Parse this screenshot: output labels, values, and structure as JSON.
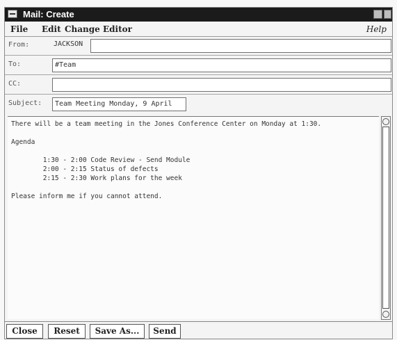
{
  "window": {
    "title": "Mail: Create"
  },
  "menu": {
    "file": "File",
    "edit": "Edit",
    "change_editor": "Change Editor",
    "help": "Help"
  },
  "header": {
    "from_label": "From:",
    "from_value": "JACKSON",
    "to_label": "To:",
    "to_value": "#Team",
    "cc_label": "CC:",
    "cc_value": "",
    "subject_label": "Subject:",
    "subject_value": "Team Meeting Monday, 9 April"
  },
  "body": {
    "lines": [
      "There will be a team meeting in the Jones Conference Center on Monday at 1:30.",
      "",
      "Agenda",
      "",
      "        1:30 - 2:00 Code Review - Send Module",
      "        2:00 - 2:15 Status of defects",
      "        2:15 - 2:30 Work plans for the week",
      "",
      "Please inform me if you cannot attend."
    ]
  },
  "buttons": {
    "close": "Close",
    "reset": "Reset",
    "save_as": "Save As...",
    "send": "Send"
  }
}
